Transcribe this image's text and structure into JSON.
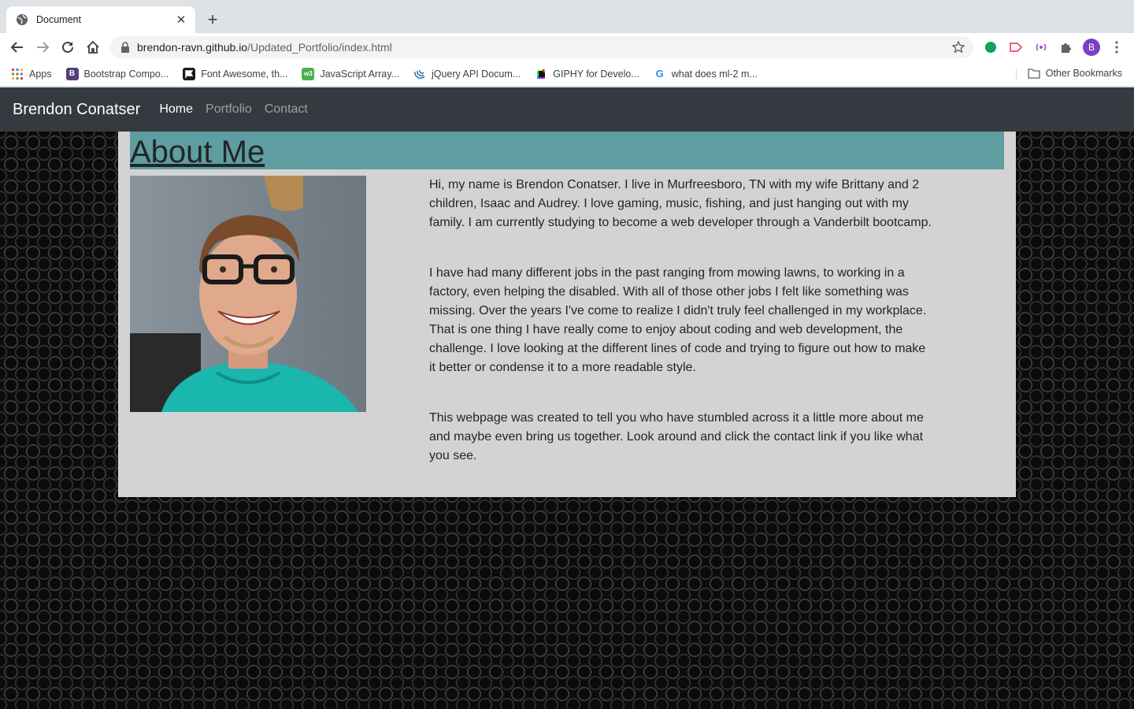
{
  "browser": {
    "tab_title": "Document",
    "url_host": "brendon-ravn.github.io",
    "url_path": "/Updated_Portfolio/index.html",
    "profile_initial": "B",
    "bookmarks": [
      {
        "label": "Apps",
        "icon": "apps-grid-icon"
      },
      {
        "label": "Bootstrap Compo...",
        "icon": "bootstrap-icon"
      },
      {
        "label": "Font Awesome, th...",
        "icon": "font-awesome-flag-icon"
      },
      {
        "label": "JavaScript Array...",
        "icon": "w3schools-icon"
      },
      {
        "label": "jQuery API Docum...",
        "icon": "jquery-icon"
      },
      {
        "label": "GIPHY for Develo...",
        "icon": "giphy-icon"
      },
      {
        "label": "what does ml-2 m...",
        "icon": "google-icon"
      }
    ],
    "other_bookmarks": "Other Bookmarks"
  },
  "site": {
    "brand": "Brendon Conatser",
    "nav": [
      "Home",
      "Portfolio",
      "Contact"
    ],
    "active_nav": "Home",
    "heading": "About Me",
    "paragraphs": [
      "Hi, my name is Brendon Conatser. I live in Murfreesboro, TN with my wife Brittany and 2 children, Isaac and Audrey. I love gaming, music, fishing, and just hanging out with my family. I am currently studying to become a web developer through a Vanderbilt bootcamp.",
      "I have had many different jobs in the past ranging from mowing lawns, to working in a factory, even helping the disabled. With all of those other jobs I felt like something was missing. Over the years I've come to realize I didn't truly feel challenged in my workplace. That is one thing I have really come to enjoy about coding and web development, the challenge. I love looking at the different lines of code and trying to figure out how to make it better or condense it to a more readable style.",
      "This webpage was created to tell you who have stumbled across it a little more about me and maybe even bring us together. Look around and click the contact link if you like what you see."
    ]
  },
  "colors": {
    "navbar": "#343a40",
    "header_band": "#5f9ea0",
    "container": "#d3d3d3"
  }
}
